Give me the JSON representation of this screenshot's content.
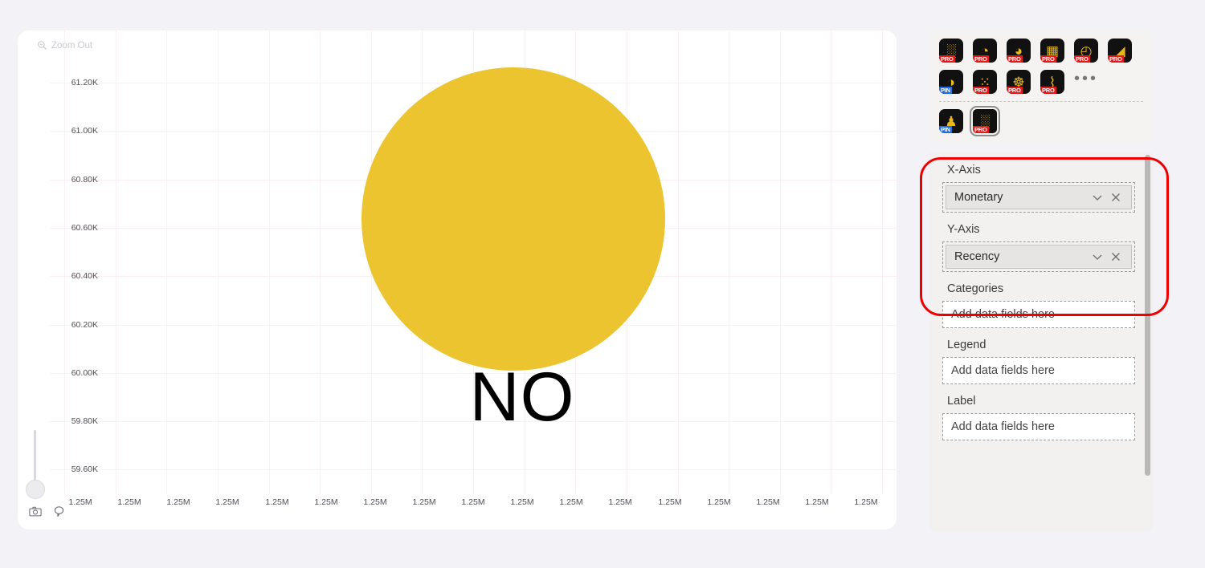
{
  "colors": {
    "page_background": "#f2f2f7",
    "chart_background": "#ffffff",
    "bubble_fill": "#ecc42f",
    "gridline": "#faf0f2",
    "panel_background": "#f2f1ef",
    "highlight_annotation": "#ee0000",
    "icon_gold": "#e5b81e",
    "badge_pro": "#e01b1b",
    "badge_pin": "#1b6fe0"
  },
  "chart": {
    "zoom_out": {
      "label": "Zoom Out",
      "icon": "zoom-out-magnifier-icon"
    },
    "bubble_label": "NO",
    "tools": [
      {
        "name": "camera-snapshot-icon",
        "title": "Snapshot"
      },
      {
        "name": "comment-bubble-icon",
        "title": "Comment"
      }
    ],
    "slider": {
      "name": "zoom-slider",
      "value": 0
    }
  },
  "chart_data": {
    "type": "scatter",
    "title": "",
    "xlabel": "Monetary",
    "ylabel": "Recency",
    "x_tick_labels": [
      "1.25M",
      "1.25M",
      "1.25M",
      "1.25M",
      "1.25M",
      "1.25M",
      "1.25M",
      "1.25M",
      "1.25M",
      "1.25M",
      "1.25M",
      "1.25M",
      "1.25M",
      "1.25M",
      "1.25M",
      "1.25M",
      "1.25M"
    ],
    "y_tick_labels": [
      "61.20K",
      "61.00K",
      "60.80K",
      "60.60K",
      "60.40K",
      "60.20K",
      "60.00K",
      "59.80K",
      "59.60K"
    ],
    "y_tick_values": [
      61200,
      61000,
      60800,
      60600,
      60400,
      60200,
      60000,
      59800,
      59600
    ],
    "ylim": [
      59500,
      61300
    ],
    "grid": true,
    "legend": "none",
    "points": [
      {
        "label": "NO",
        "x": 1250000,
        "y": 60700,
        "color": "#ecc42f",
        "radius_px": 189
      }
    ]
  },
  "visuals_toolbar": {
    "rows": [
      [
        {
          "name": "scatter-chart-icon",
          "glyph": "░",
          "badge": "PRO"
        },
        {
          "name": "donut-chart-icon",
          "glyph": "◔",
          "badge": "PRO"
        },
        {
          "name": "pie-chart-icon",
          "glyph": "◕",
          "badge": "PRO"
        },
        {
          "name": "treemap-icon",
          "glyph": "▦",
          "badge": "PRO"
        },
        {
          "name": "clock-gauge-icon",
          "glyph": "◴",
          "badge": "PRO"
        },
        {
          "name": "funnel-icon",
          "glyph": "◢",
          "badge": "PRO"
        }
      ],
      [
        {
          "name": "sunburst-chart-icon",
          "glyph": "◑",
          "badge": "PIN"
        },
        {
          "name": "bubble-cloud-icon",
          "glyph": "⁙",
          "badge": "PRO"
        },
        {
          "name": "network-graph-icon",
          "glyph": "☸",
          "badge": "PRO"
        },
        {
          "name": "area-chart-icon",
          "glyph": "⌇",
          "badge": "PRO"
        },
        {
          "name": "more-visuals-icon",
          "glyph": "•••",
          "badge": ""
        }
      ],
      [
        {
          "name": "people-chart-icon",
          "glyph": "♟",
          "badge": "PIN"
        },
        {
          "name": "bubble-matrix-icon",
          "glyph": "░",
          "badge": "PRO",
          "selected": true
        }
      ]
    ]
  },
  "fields_panel": {
    "wells": [
      {
        "name": "x-axis",
        "label": "X-Axis",
        "field": "Monetary",
        "has_field": true,
        "dropdown_icon": "chevron-down-icon",
        "remove_icon": "close-x-icon"
      },
      {
        "name": "y-axis",
        "label": "Y-Axis",
        "field": "Recency",
        "has_field": true,
        "dropdown_icon": "chevron-down-icon",
        "remove_icon": "close-x-icon"
      },
      {
        "name": "categories",
        "label": "Categories",
        "placeholder": "Add data fields here",
        "has_field": false
      },
      {
        "name": "legend",
        "label": "Legend",
        "placeholder": "Add data fields here",
        "has_field": false
      },
      {
        "name": "label",
        "label": "Label",
        "placeholder": "Add data fields here",
        "has_field": false
      }
    ]
  }
}
